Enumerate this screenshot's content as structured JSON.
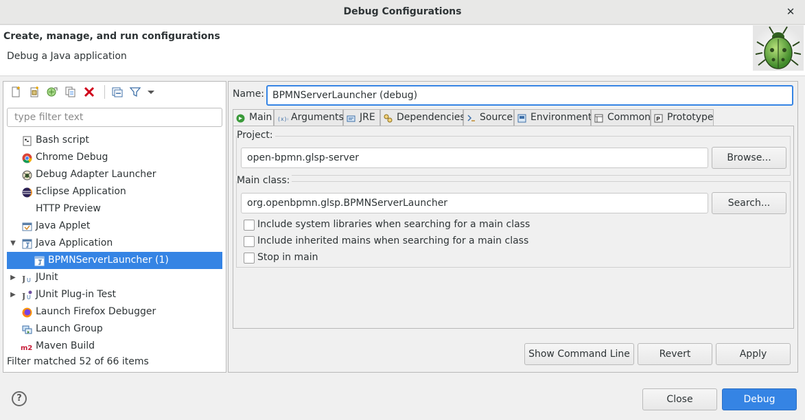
{
  "window": {
    "title": "Debug Configurations",
    "close_glyph": "✕"
  },
  "header": {
    "title": "Create, manage, and run configurations",
    "subtitle": "Debug a Java application",
    "logo_icon": "bug-icon"
  },
  "left_toolbar": {
    "buttons": [
      "new-configuration-icon",
      "new-prototype-icon",
      "export-icon",
      "duplicate-icon",
      "delete-icon",
      "collapse-all-icon",
      "filter-icon",
      "view-menu-icon"
    ]
  },
  "filter": {
    "placeholder": "type filter text",
    "value": ""
  },
  "tree": {
    "items": [
      {
        "label": "Bash script",
        "icon": "bash-icon",
        "expander": ""
      },
      {
        "label": "Chrome Debug",
        "icon": "chrome-icon",
        "expander": ""
      },
      {
        "label": "Debug Adapter Launcher",
        "icon": "debug-adapter-icon",
        "expander": ""
      },
      {
        "label": "Eclipse Application",
        "icon": "eclipse-icon",
        "expander": ""
      },
      {
        "label": "HTTP Preview",
        "icon": "http-preview-icon",
        "expander": ""
      },
      {
        "label": "Java Applet",
        "icon": "java-applet-icon",
        "expander": ""
      },
      {
        "label": "Java Application",
        "icon": "java-application-icon",
        "expander": "▼"
      },
      {
        "label": "BPMNServerLauncher (1)",
        "icon": "java-launch-config-icon",
        "expander": ""
      },
      {
        "label": "JUnit",
        "icon": "junit-icon",
        "expander": "▶"
      },
      {
        "label": "JUnit Plug-in Test",
        "icon": "junit-plugin-icon",
        "expander": "▶"
      },
      {
        "label": "Launch Firefox Debugger",
        "icon": "firefox-icon",
        "expander": ""
      },
      {
        "label": "Launch Group",
        "icon": "launch-group-icon",
        "expander": ""
      },
      {
        "label": "Maven Build",
        "icon": "maven-icon",
        "expander": ""
      }
    ],
    "status": "Filter matched 52 of 66 items"
  },
  "config": {
    "name_label": "Name:",
    "name_value": "BPMNServerLauncher (debug)",
    "tabs": [
      {
        "label": "Main",
        "icon": "main-tab-icon"
      },
      {
        "label": "Arguments",
        "icon": "arguments-icon"
      },
      {
        "label": "JRE",
        "icon": "jre-icon"
      },
      {
        "label": "Dependencies",
        "icon": "dependencies-icon"
      },
      {
        "label": "Source",
        "icon": "source-icon"
      },
      {
        "label": "Environment",
        "icon": "environment-icon"
      },
      {
        "label": "Common",
        "icon": "common-icon"
      },
      {
        "label": "Prototype",
        "icon": "prototype-icon"
      }
    ],
    "project_label": "Project:",
    "project_value": "open-bpmn.glsp-server",
    "browse_button": "Browse...",
    "main_class_label": "Main class:",
    "main_class_value": "org.openbpmn.glsp.BPMNServerLauncher",
    "search_button": "Search...",
    "checkboxes": [
      {
        "label": "Include system libraries when searching for a main class",
        "checked": false
      },
      {
        "label": "Include inherited mains when searching for a main class",
        "checked": false
      },
      {
        "label": "Stop in main",
        "checked": false
      }
    ],
    "show_command_line": "Show Command Line",
    "revert": "Revert",
    "apply": "Apply"
  },
  "footer": {
    "help_icon": "?",
    "close_button": "Close",
    "debug_button": "Debug"
  },
  "colors": {
    "accent": "#3584e4",
    "error": "#d0021b"
  }
}
